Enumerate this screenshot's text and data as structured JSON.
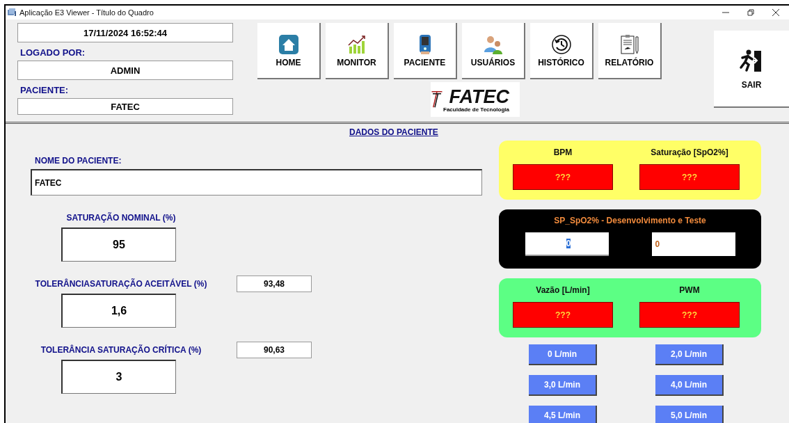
{
  "window": {
    "title": "Aplicação E3 Viewer - Título do Quadro"
  },
  "header": {
    "datetime": "17/11/2024 16:52:44",
    "user_label": "LOGADO POR:",
    "user": "ADMIN",
    "patient_label": "PACIENTE:",
    "patient": "FATEC",
    "nav_buttons": [
      {
        "label": "HOME",
        "kind": "home"
      },
      {
        "label": "MONITOR",
        "kind": "chart"
      },
      {
        "label": "PACIENTE",
        "kind": "oximeter"
      },
      {
        "label": "USUÁRIOS",
        "kind": "users"
      },
      {
        "label": "HISTÓRICO",
        "kind": "history"
      },
      {
        "label": "RELATÓRIO",
        "kind": "report"
      }
    ],
    "logo": {
      "name": "FATEC",
      "subtitle": "Faculdade de Tecnologia"
    },
    "exit_button": {
      "label": "SAIR"
    }
  },
  "section_title": "DADOS DO PACIENTE",
  "patient_name": {
    "label": "NOME DO PACIENTE:",
    "value": "FATEC"
  },
  "parameters": [
    {
      "label": "SATURAÇÃO NOMINAL (%)",
      "value": "95"
    },
    {
      "label": "TOLERÂNCIASATURAÇÃO ACEITÁVEL  (%)",
      "value": "1,6",
      "result": "93,48"
    },
    {
      "label": "TOLERÂNCIA SATURAÇÃO CRÍTICA  (%)",
      "value": "3",
      "result": "90,63"
    }
  ],
  "panels": [
    {
      "kind": "readings",
      "color": "#ffff66",
      "fields": [
        {
          "label": "BPM",
          "value": "???"
        },
        {
          "label": "Saturação [SpO2%]",
          "value": "???"
        }
      ]
    },
    {
      "kind": "test",
      "color": "#000000",
      "title": "SP_SpO2% - Desenvolvimento e Teste",
      "inputs": [
        {
          "value": "0",
          "selected": true
        },
        {
          "value": "0",
          "selected": false
        }
      ]
    },
    {
      "kind": "readings",
      "color": "#5cff84",
      "fields": [
        {
          "label": "Vazão [L/min]",
          "value": "???"
        },
        {
          "label": "PWM",
          "value": "???"
        }
      ]
    }
  ],
  "flow_buttons": [
    "0 L/min",
    "2,0 L/min",
    "3,0 L/min",
    "4,0 L/min",
    "4,5 L/min",
    "5,0 L/min"
  ]
}
